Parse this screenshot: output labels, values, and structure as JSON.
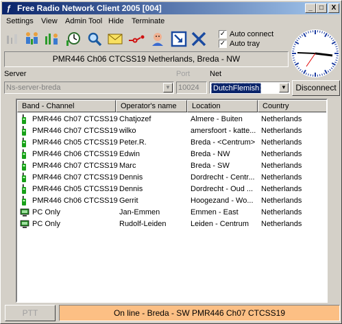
{
  "window": {
    "title": "Free Radio Network Client 2005 [004]",
    "app_icon": "antenna-icon",
    "controls": {
      "minimize": "_",
      "maximize": "□",
      "close": "X"
    }
  },
  "menu": [
    "Settings",
    "View",
    "Admin Tool",
    "Hide",
    "Terminate"
  ],
  "toolbar": {
    "buttons": [
      "disabled-channel-icon",
      "people-icon",
      "contacts-icon",
      "clock-tool-icon",
      "search-icon",
      "mail-icon",
      "connect-link-icon",
      "user-face-icon",
      "minimize-arrow-icon",
      "close-x-icon"
    ],
    "auto_connect": {
      "label": "Auto connect",
      "checked": true
    },
    "auto_tray": {
      "label": "Auto tray",
      "checked": true
    }
  },
  "status_top": "PMR446 Ch06 CTCSS19 Netherlands, Breda - NW",
  "connection": {
    "server_label": "Server",
    "server_value": "Ns-server-breda",
    "port_label": "Port",
    "port_value": "10024",
    "net_label": "Net",
    "net_value": "DutchFlemish",
    "disconnect_label": "Disconnect"
  },
  "list": {
    "columns": [
      "Band - Channel",
      "Operator's name",
      "Location",
      "Country"
    ],
    "rows": [
      {
        "type": "radio",
        "channel": "PMR446 Ch07 CTCSS19",
        "operator": "Chatjozef",
        "location": "Almere - Buiten",
        "country": "Netherlands"
      },
      {
        "type": "radio",
        "channel": "PMR446 Ch07 CTCSS19",
        "operator": "wilko",
        "location": "amersfoort - katte...",
        "country": "Netherlands"
      },
      {
        "type": "radio",
        "channel": "PMR446 Ch05 CTCSS19",
        "operator": "Peter.R.",
        "location": "Breda - <Centrum>",
        "country": "Netherlands"
      },
      {
        "type": "radio",
        "channel": "PMR446 Ch06 CTCSS19",
        "operator": "Edwin",
        "location": "Breda - NW",
        "country": "Netherlands"
      },
      {
        "type": "radio",
        "channel": "PMR446 Ch07 CTCSS19",
        "operator": "Marc",
        "location": "Breda - SW",
        "country": "Netherlands"
      },
      {
        "type": "radio",
        "channel": "PMR446 Ch07 CTCSS19",
        "operator": "Dennis",
        "location": "Dordrecht - Centr...",
        "country": "Netherlands"
      },
      {
        "type": "radio",
        "channel": "PMR446 Ch05 CTCSS19",
        "operator": "Dennis",
        "location": "Dordrecht - Oud ...",
        "country": "Netherlands"
      },
      {
        "type": "radio",
        "channel": "PMR446 Ch06 CTCSS19",
        "operator": "Gerrit",
        "location": "Hoogezand - Wo...",
        "country": "Netherlands"
      },
      {
        "type": "pc",
        "channel": "PC Only",
        "operator": "Jan-Emmen",
        "location": "Emmen - East",
        "country": "Netherlands"
      },
      {
        "type": "pc",
        "channel": "PC Only",
        "operator": "Rudolf-Leiden",
        "location": "Leiden - Centrum",
        "country": "Netherlands"
      }
    ]
  },
  "ptt_label": "PTT",
  "status_bottom": "On line - Breda - SW PMR446 Ch07 CTCSS19",
  "colors": {
    "title_start": "#0a246a",
    "status_bottom": "#fcbf84",
    "radio_icon": "#18a018",
    "pc_icon": "#2a8a2a"
  }
}
